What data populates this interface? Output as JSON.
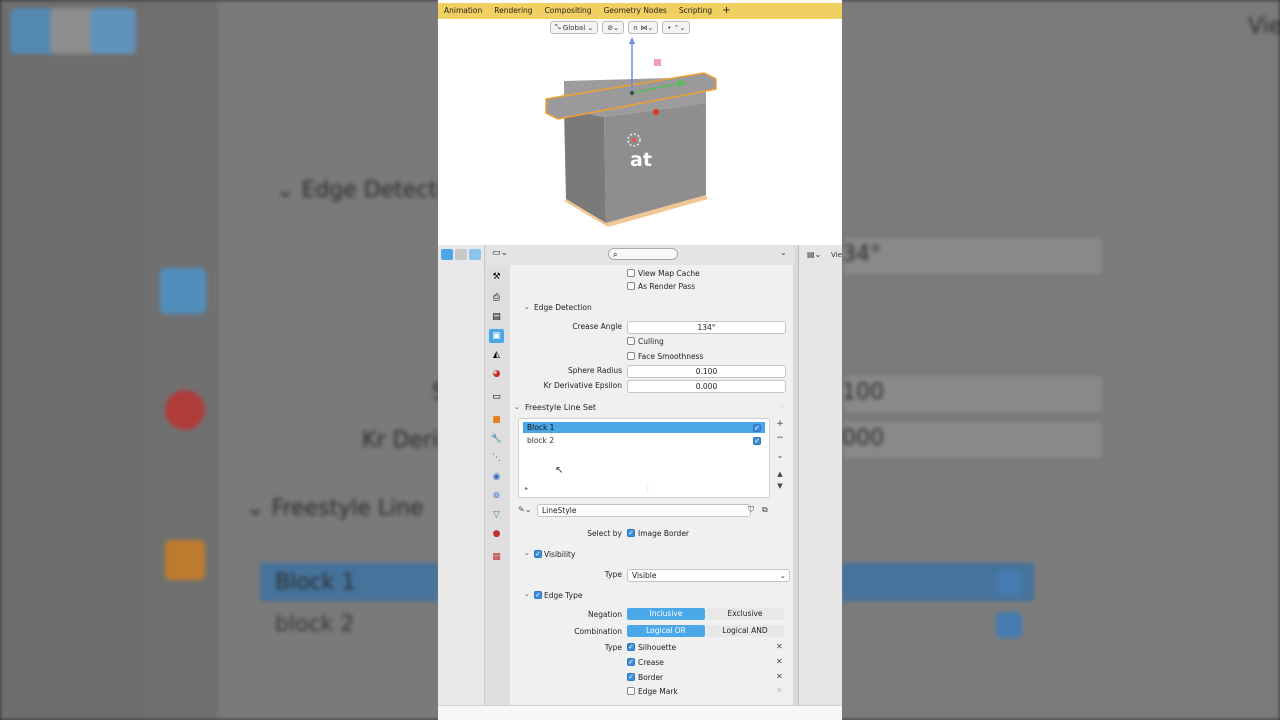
{
  "background": {
    "edge_detection_title": "Edge Detection",
    "freestyle_title": "Freestyle Line",
    "block1": "Block 1",
    "block2": "block 2",
    "kr_partial": "Kr Deri",
    "s_partial": "S",
    "crease_value_partial": "34°",
    "sphere_value_partial": "100",
    "kr_value_partial": "000",
    "view_partial": "Vie"
  },
  "topbar": {
    "tabs": [
      "Animation",
      "Rendering",
      "Compositing",
      "Geometry Nodes",
      "Scripting",
      "+"
    ]
  },
  "viewport": {
    "orientation": "Global",
    "caption": "at"
  },
  "header": {
    "search_placeholder": "",
    "right_label": "Vie"
  },
  "props": {
    "view_map_cache": "View Map Cache",
    "as_render_pass": "As Render Pass",
    "edge_detection": {
      "title": "Edge Detection",
      "crease_angle_label": "Crease Angle",
      "crease_angle_value": "134°",
      "culling_label": "Culling",
      "face_smoothness_label": "Face Smoothness",
      "sphere_radius_label": "Sphere Radius",
      "sphere_radius_value": "0.100",
      "kr_label": "Kr Derivative Epsilon",
      "kr_value": "0.000"
    },
    "freestyle_line_set": {
      "title": "Freestyle Line Set",
      "items": [
        {
          "name": "Block 1",
          "checked": true,
          "selected": true
        },
        {
          "name": "block 2",
          "checked": true,
          "selected": false
        }
      ],
      "linestyle": "LineStyle",
      "select_by_label": "Select by",
      "image_border_label": "Image Border"
    },
    "visibility": {
      "title": "Visibility",
      "type_label": "Type",
      "type_value": "Visible"
    },
    "edge_type": {
      "title": "Edge Type",
      "negation_label": "Negation",
      "negation_options": [
        "Inclusive",
        "Exclusive"
      ],
      "combination_label": "Combination",
      "combination_options": [
        "Logical OR",
        "Logical AND"
      ],
      "type_label": "Type",
      "types": [
        {
          "name": "Silhouette",
          "checked": true
        },
        {
          "name": "Crease",
          "checked": true
        },
        {
          "name": "Border",
          "checked": true
        },
        {
          "name": "Edge Mark",
          "checked": false
        }
      ]
    }
  },
  "colors": {
    "accent": "#4aa8e8",
    "topbar": "#f0d060",
    "object_outline": "#f0a030"
  }
}
